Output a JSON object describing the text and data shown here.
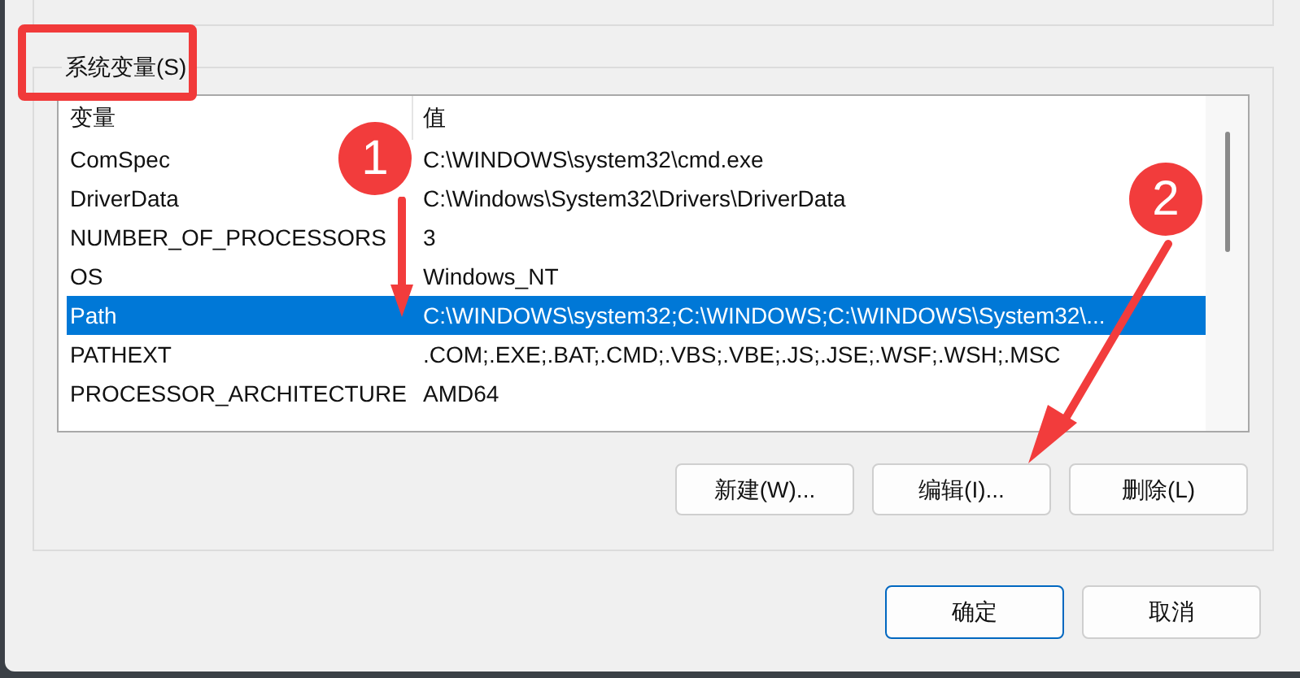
{
  "group": {
    "title": "系统变量(S)"
  },
  "table": {
    "columns": [
      "变量",
      "值"
    ],
    "rows": [
      {
        "name": "ComSpec",
        "value": "C:\\WINDOWS\\system32\\cmd.exe",
        "selected": false
      },
      {
        "name": "DriverData",
        "value": "C:\\Windows\\System32\\Drivers\\DriverData",
        "selected": false
      },
      {
        "name": "NUMBER_OF_PROCESSORS",
        "value": "3",
        "selected": false
      },
      {
        "name": "OS",
        "value": "Windows_NT",
        "selected": false
      },
      {
        "name": "Path",
        "value": "C:\\WINDOWS\\system32;C:\\WINDOWS;C:\\WINDOWS\\System32\\...",
        "selected": true
      },
      {
        "name": "PATHEXT",
        "value": ".COM;.EXE;.BAT;.CMD;.VBS;.VBE;.JS;.JSE;.WSF;.WSH;.MSC",
        "selected": false
      },
      {
        "name": "PROCESSOR_ARCHITECTURE",
        "value": "AMD64",
        "selected": false
      }
    ]
  },
  "group_buttons": [
    "新建(W)...",
    "编辑(I)...",
    "删除(L)"
  ],
  "dialog_buttons": [
    {
      "label": "确定",
      "default": true
    },
    {
      "label": "取消",
      "default": false
    }
  ],
  "annotations": [
    {
      "number": "1"
    },
    {
      "number": "2"
    }
  ]
}
